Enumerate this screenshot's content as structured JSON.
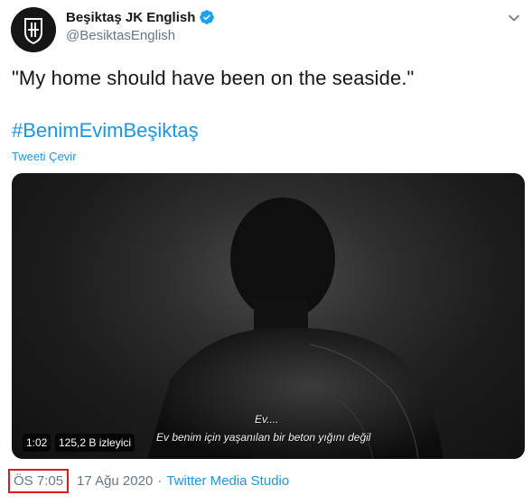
{
  "account": {
    "display_name": "Beşiktaş JK English",
    "handle": "@BesiktasEnglish",
    "avatar_icon": "besiktas-crest-icon",
    "verified_icon": "verified-badge-icon",
    "verified_color": "#1da1f2"
  },
  "tweet": {
    "text": "\"My home should have been on the seaside.\"",
    "hashtag": "#BenimEvimBeşiktaş",
    "translate_label": "Tweeti Çevir"
  },
  "video": {
    "subtitle_line1": "Ev....",
    "subtitle_line2": "Ev benim için yaşanılan bir beton yığını değil",
    "duration": "1:02",
    "views": "125,2 B izleyici"
  },
  "meta": {
    "time": "ÖS 7:05",
    "date": "17 Ağu 2020",
    "separator": "·",
    "source": "Twitter Media Studio"
  },
  "colors": {
    "link": "#1b95e0",
    "secondary_text": "#657786",
    "highlight_box": "#e01818"
  }
}
